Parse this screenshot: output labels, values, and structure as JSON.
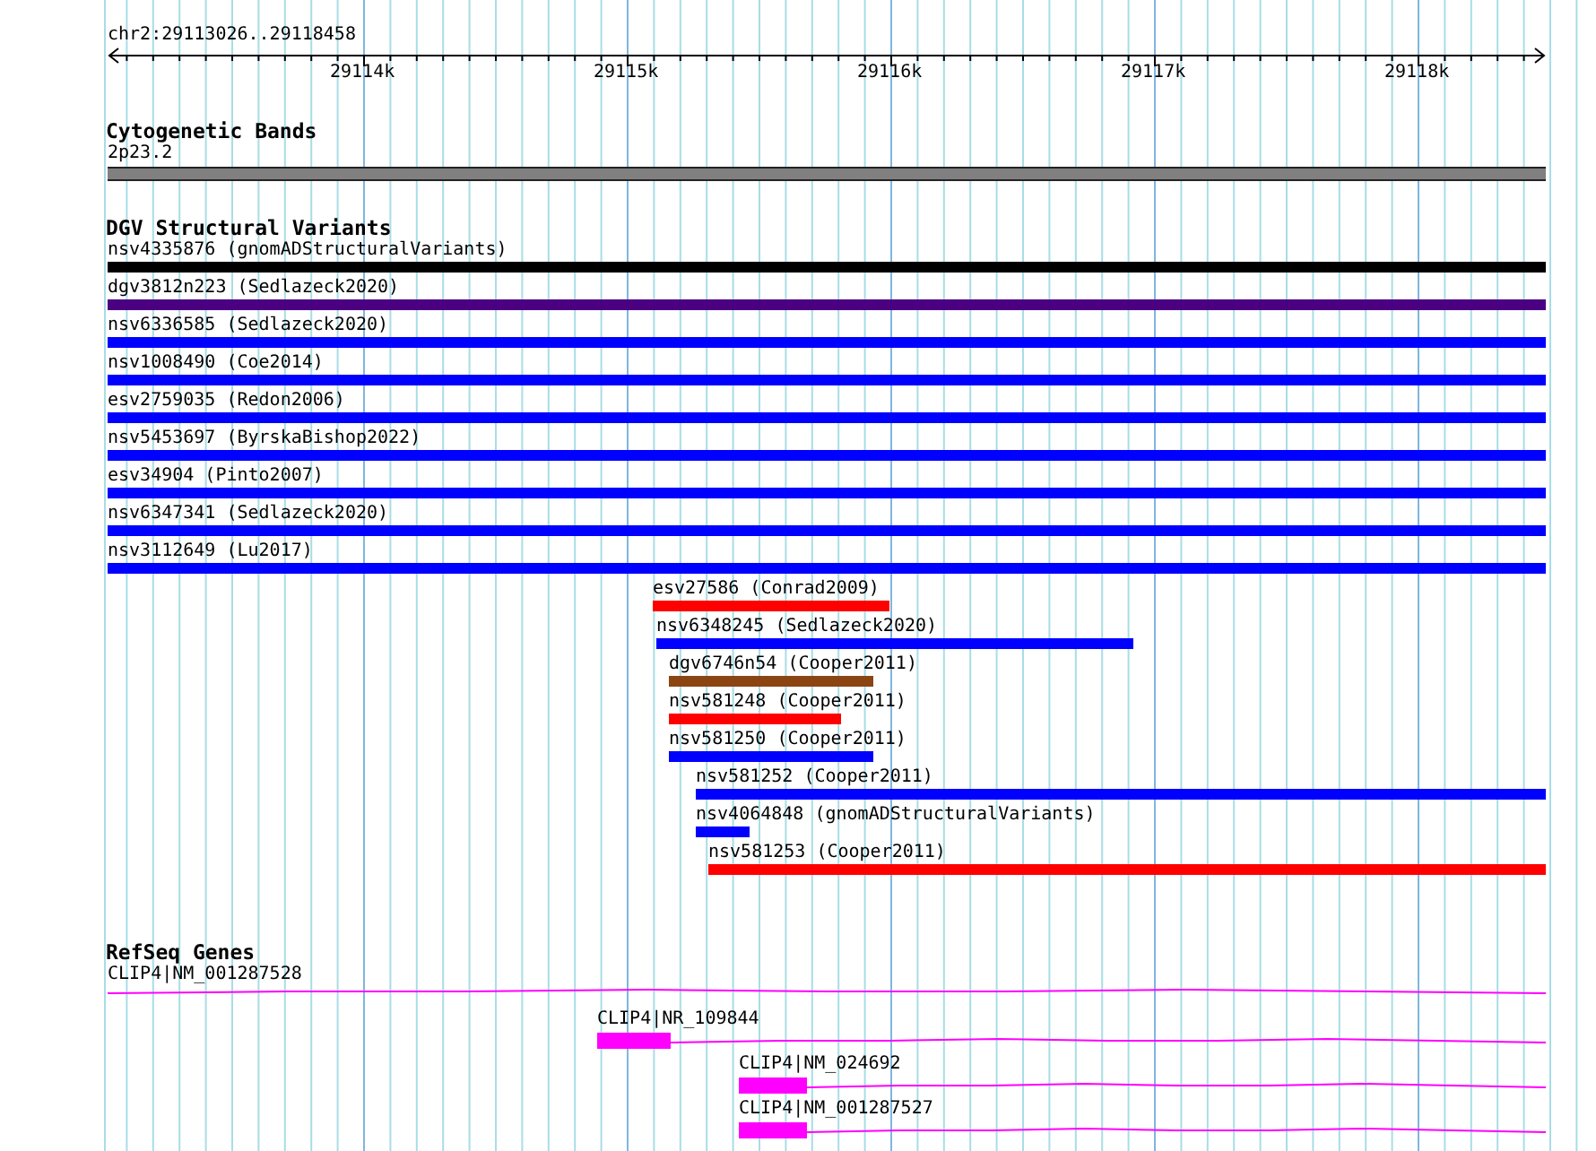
{
  "location": "chr2:29113026..29118458",
  "ruler": {
    "ticks": [
      "29114k",
      "29115k",
      "29116k",
      "29117k",
      "29118k"
    ]
  },
  "tracks": [
    {
      "kind": "bands",
      "title": "Cytogenetic Bands",
      "features": [
        {
          "label": "2p23.2",
          "color": "#808080"
        }
      ]
    },
    {
      "kind": "variants",
      "title": "DGV Structural Variants",
      "features": [
        {
          "label": "nsv4335876 (gnomADStructuralVariants)",
          "color": "#000000"
        },
        {
          "label": "dgv3812n223 (Sedlazeck2020)",
          "color": "#4b0082"
        },
        {
          "label": "nsv6336585 (Sedlazeck2020)",
          "color": "#0000ff"
        },
        {
          "label": "nsv1008490 (Coe2014)",
          "color": "#0000ff"
        },
        {
          "label": "esv2759035 (Redon2006)",
          "color": "#0000ff"
        },
        {
          "label": "nsv5453697 (ByrskaBishop2022)",
          "color": "#0000ff"
        },
        {
          "label": "esv34904 (Pinto2007)",
          "color": "#0000ff"
        },
        {
          "label": "nsv6347341 (Sedlazeck2020)",
          "color": "#0000ff"
        },
        {
          "label": "nsv3112649 (Lu2017)",
          "color": "#0000ff"
        },
        {
          "label": "esv27586 (Conrad2009)",
          "color": "#ff0000"
        },
        {
          "label": "nsv6348245 (Sedlazeck2020)",
          "color": "#0000ff"
        },
        {
          "label": "dgv6746n54 (Cooper2011)",
          "color": "#8b4513"
        },
        {
          "label": "nsv581248 (Cooper2011)",
          "color": "#ff0000"
        },
        {
          "label": "nsv581250 (Cooper2011)",
          "color": "#0000ff"
        },
        {
          "label": "nsv581252 (Cooper2011)",
          "color": "#0000ff"
        },
        {
          "label": "nsv4064848 (gnomADStructuralVariants)",
          "color": "#0000ff"
        },
        {
          "label": "nsv581253 (Cooper2011)",
          "color": "#ff0000"
        }
      ]
    },
    {
      "kind": "genes",
      "title": "RefSeq Genes",
      "features": [
        {
          "label": "CLIP4|NM_001287528"
        },
        {
          "label": "CLIP4|NR_109844"
        },
        {
          "label": "CLIP4|NM_024692"
        },
        {
          "label": "CLIP4|NM_001287527"
        }
      ]
    }
  ]
}
